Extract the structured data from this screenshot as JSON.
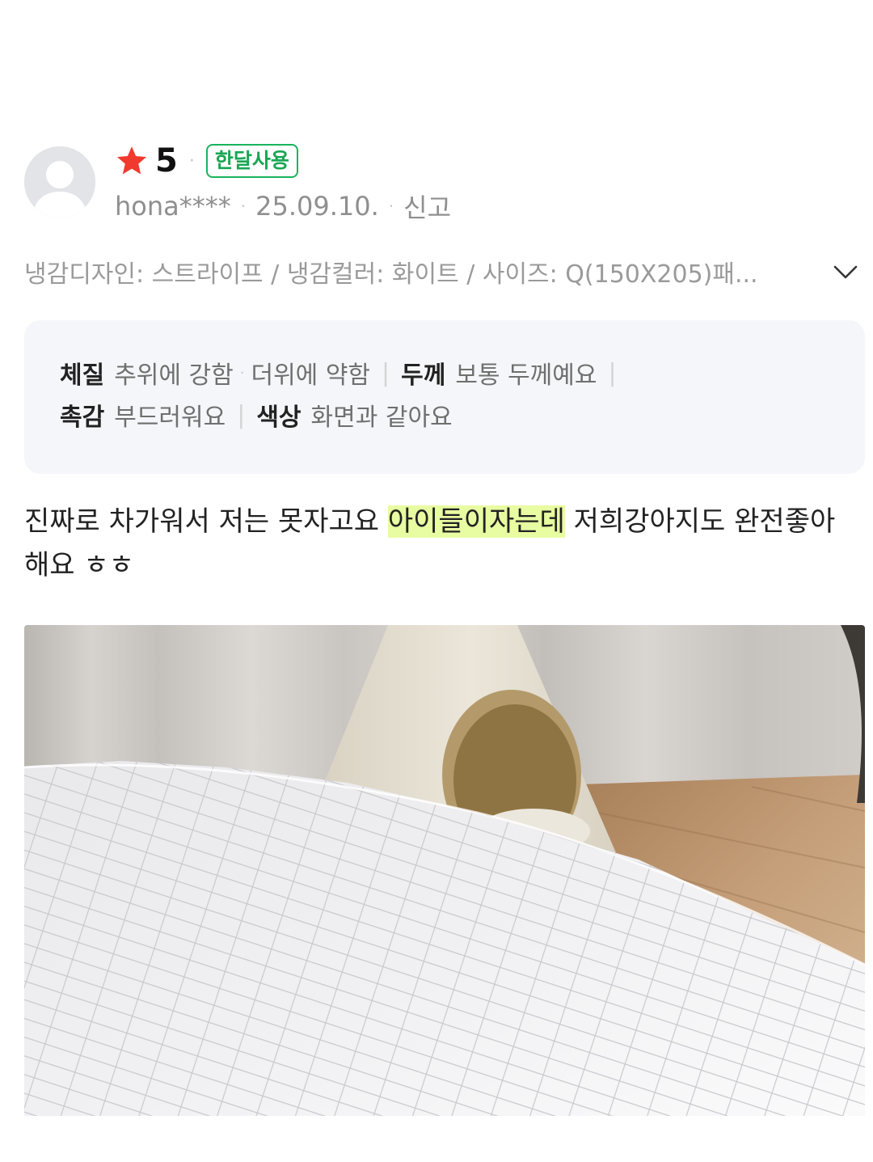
{
  "review": {
    "avatar": "user-placeholder-icon",
    "rating": "5",
    "badge": "한달사용",
    "author": "hona****",
    "date": "25.09.10.",
    "report": "신고",
    "options": "냉감디자인: 스트라이프 / 냉감컬러: 화이트 / 사이즈: Q(150X205)패...",
    "attributes": [
      {
        "key": "체질",
        "value_a": "추위에 강함",
        "value_b": "더위에 약함"
      },
      {
        "key": "두께",
        "value": "보통 두께예요"
      },
      {
        "key": "촉감",
        "value": "부드러워요"
      },
      {
        "key": "색상",
        "value": "화면과 같아요"
      }
    ],
    "text_before": "진짜로 차가워서 저는 못자고요 ",
    "text_highlight": "아이들이자는데",
    "text_after": " 저희강아지도 완전좋아해요 ㅎㅎ",
    "photo": "photo-bed-pad-with-pet-tent"
  },
  "colors": {
    "star": "#f03a2e",
    "badge": "#19b45d",
    "highlight": "#e8fca2",
    "attr_bg": "#f5f6f9"
  }
}
